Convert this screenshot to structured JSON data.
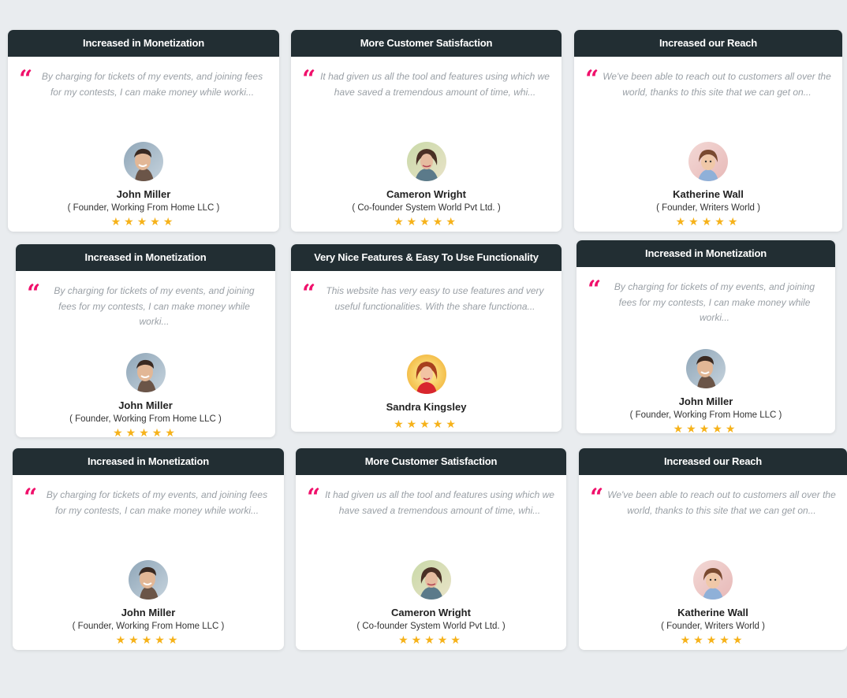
{
  "quote_glyph": "“",
  "cards": [
    {
      "title": "Increased in Monetization",
      "quote": "By charging for tickets of my events, and joining fees for my contests, I can make money while worki...",
      "name": "John Miller",
      "role": "( Founder, Working From Home LLC )",
      "stars": "★★★★★",
      "rating": 5,
      "avatar": "john-miller"
    },
    {
      "title": "More Customer Satisfaction",
      "quote": "It had given us all the tool and features using which we have saved a tremendous amount of time, whi...",
      "name": "Cameron Wright",
      "role": "( Co-founder System World Pvt Ltd. )",
      "stars": "★★★★★",
      "rating": 5,
      "avatar": "cameron-wright"
    },
    {
      "title": "Increased our Reach",
      "quote": "We've been able to reach out to customers all over the world, thanks to this site that we can get on...",
      "name": "Katherine Wall",
      "role": "( Founder, Writers World )",
      "stars": "★★★★★",
      "rating": 5,
      "avatar": "katherine-wall"
    },
    {
      "title": "Increased in Monetization",
      "quote": "By charging for tickets of my events, and joining fees for my contests, I can make money while worki...",
      "name": "John Miller",
      "role": "( Founder, Working From Home LLC )",
      "stars": "★★★★★",
      "rating": 5,
      "avatar": "john-miller"
    },
    {
      "title": "Very Nice Features & Easy To Use Functionality",
      "quote": "This website has very easy to use features and very useful functionalities. With the share functiona...",
      "name": "Sandra Kingsley",
      "role": "",
      "stars": "★★★★★",
      "rating": 5,
      "avatar": "sandra-kingsley"
    },
    {
      "title": "Increased in Monetization",
      "quote": "By charging for tickets of my events, and joining fees for my contests, I can make money while worki...",
      "name": "John Miller",
      "role": "( Founder, Working From Home LLC )",
      "stars": "★★★★★",
      "rating": 5,
      "avatar": "john-miller"
    },
    {
      "title": "Increased in Monetization",
      "quote": "By charging for tickets of my events, and joining fees for my contests, I can make money while worki...",
      "name": "John Miller",
      "role": "( Founder, Working From Home LLC )",
      "stars": "★★★★★",
      "rating": 5,
      "avatar": "john-miller"
    },
    {
      "title": "More Customer Satisfaction",
      "quote": "It had given us all the tool and features using which we have saved a tremendous amount of time, whi...",
      "name": "Cameron Wright",
      "role": "( Co-founder System World Pvt Ltd. )",
      "stars": "★★★★★",
      "rating": 5,
      "avatar": "cameron-wright"
    },
    {
      "title": "Increased our Reach",
      "quote": "We've been able to reach out to customers all over the world, thanks to this site that we can get on...",
      "name": "Katherine Wall",
      "role": "( Founder, Writers World )",
      "stars": "★★★★★",
      "rating": 5,
      "avatar": "katherine-wall"
    }
  ],
  "colors": {
    "header_bg": "#222e33",
    "quote_accent": "#f0106b",
    "star": "#f6b21a",
    "page_bg": "#e9ecef"
  }
}
